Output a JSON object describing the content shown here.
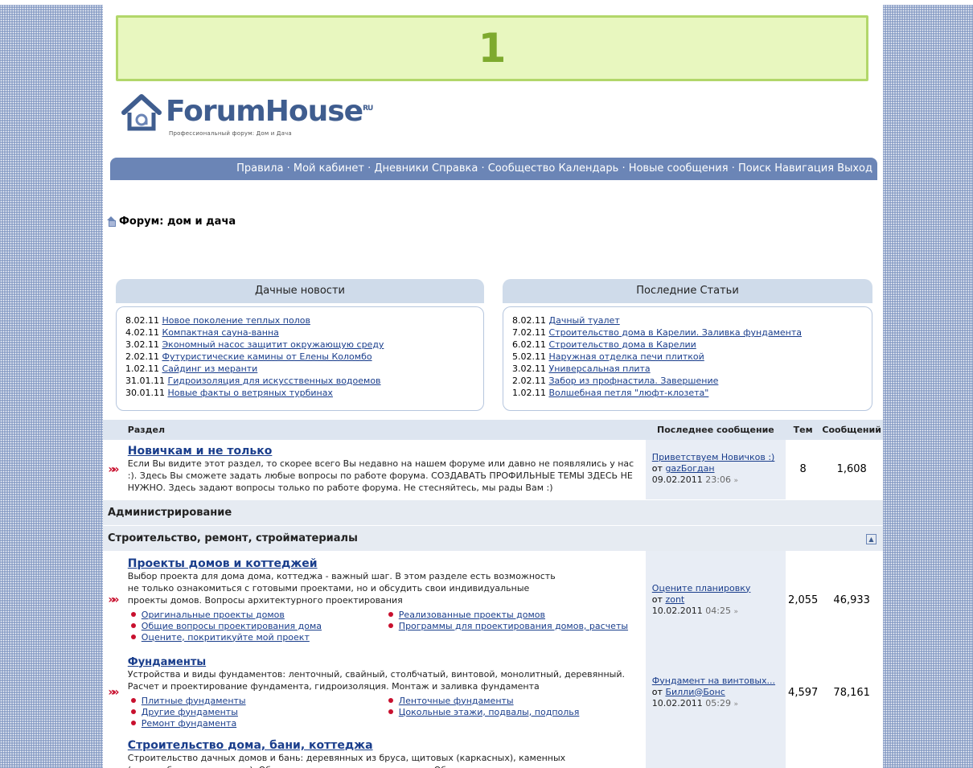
{
  "banner": {
    "text": "1"
  },
  "logo": {
    "name": "ForumHouse",
    "sup": "RU",
    "tagline": "Профессиональный форум: Дом и Дача"
  },
  "nav": {
    "text": "Правила · Мой кабинет · Дневники Справка · Сообщество Календарь · Новые сообщения · Поиск Навигация Выход"
  },
  "breadcrumb": {
    "title": "Форум: дом и дача"
  },
  "news": {
    "title": "Дачные новости",
    "items": [
      {
        "date": "8.02.11",
        "title": "Новое поколение теплых полов"
      },
      {
        "date": "4.02.11",
        "title": "Компактная сауна-ванна"
      },
      {
        "date": "3.02.11",
        "title": "Экономный насос защитит окружающую среду"
      },
      {
        "date": "2.02.11",
        "title": "Футуристические камины от Елены Коломбо"
      },
      {
        "date": "1.02.11",
        "title": "Сайдинг из меранти"
      },
      {
        "date": "31.01.11",
        "title": "Гидроизоляция для искусственных водоемов"
      },
      {
        "date": "30.01.11",
        "title": "Новые факты о ветряных турбинах"
      }
    ]
  },
  "articles": {
    "title": "Последние Статьи",
    "items": [
      {
        "date": "8.02.11",
        "title": "Дачный туалет"
      },
      {
        "date": "7.02.11",
        "title": "Строительство дома в Карелии. Заливка фундамента"
      },
      {
        "date": "6.02.11",
        "title": "Строительство дома в Карелии"
      },
      {
        "date": "5.02.11",
        "title": "Наружная отделка печи плиткой"
      },
      {
        "date": "3.02.11",
        "title": "Универсальная плита"
      },
      {
        "date": "2.02.11",
        "title": "Забор из профнастила. Завершение"
      },
      {
        "date": "1.02.11",
        "title": "Волшебная петля \"люфт-клозета\""
      }
    ]
  },
  "table": {
    "headers": {
      "section": "Раздел",
      "last": "Последнее сообщение",
      "threads": "Тем",
      "posts": "Сообщений"
    }
  },
  "forums": {
    "novice": {
      "title": "Новичкам и не только",
      "desc": "Если Вы видите этот раздел, то скорее всего Вы недавно на нашем форуме или давно не появлялись у нас :). Здесь Вы сможете задать любые вопросы по работе форума. СОЗДАВАТЬ ПРОФИЛЬНЫЕ ТЕМЫ ЗДЕСЬ НЕ НУЖНО. Здесь задают вопросы только по работе форума. Не стесняйтесь, мы рады Вам :)",
      "last_title": "Приветствуем Новичков :)",
      "last_by": "от",
      "last_user": "gazБогдан",
      "last_date": "09.02.2011",
      "last_time": "23:06",
      "threads": "8",
      "posts": "1,608"
    },
    "projects": {
      "title": "Проекты домов и коттеджей",
      "desc": "Выбор проекта для дома дома, коттеджа - важный шаг. В этом разделе есть возможность не только ознакомиться с готовыми проектами, но и обсудить свои индивидуальные проекты домов. Вопросы архитектурного проектирования",
      "subs": [
        "Оригинальные проекты домов",
        "Реализованные проекты домов",
        "Общие вопросы проектирования дома",
        "Программы для проектирования домов, расчеты",
        "Оцените, покритикуйте мой проект"
      ],
      "last_title": "Оцените планировку",
      "last_by": "от",
      "last_user": "zont",
      "last_date": "10.02.2011",
      "last_time": "04:25",
      "threads": "2,055",
      "posts": "46,933"
    },
    "foundations": {
      "title": "Фундаменты",
      "desc": "Устройства и виды фундаментов: ленточный, свайный, столбчатый, винтовой, монолитный, деревянный. Расчет и проектирование фундамента, гидроизоляция. Монтаж и заливка фундамента",
      "subs": [
        "Плитные фундаменты",
        "Ленточные фундаменты",
        "Другие фундаменты",
        "Цокольные этажи, подвалы, подполья",
        "Ремонт фундамента"
      ],
      "last_title": "Фундамент на винтовых...",
      "last_by": "от",
      "last_user": "Билли@Бонс",
      "last_date": "10.02.2011",
      "last_time": "05:29",
      "threads": "4,597",
      "posts": "78,161"
    },
    "building": {
      "title": "Строительство дома, бани, коттеджа",
      "desc": "Строительство дачных домов и бань: деревянных из бруса, щитовых (каркасных), каменных (из пеноблоков и кирпича). Обсуждение смет на строительство. Общие вопросы"
    }
  },
  "categories": {
    "admin": "Администрирование",
    "construction": "Строительство, ремонт, стройматериалы"
  },
  "colors": {
    "accent": "#6b85b6",
    "link": "#1a3e8c",
    "arrow": "#c8102e",
    "banner_bg": "#e8f7bf"
  }
}
